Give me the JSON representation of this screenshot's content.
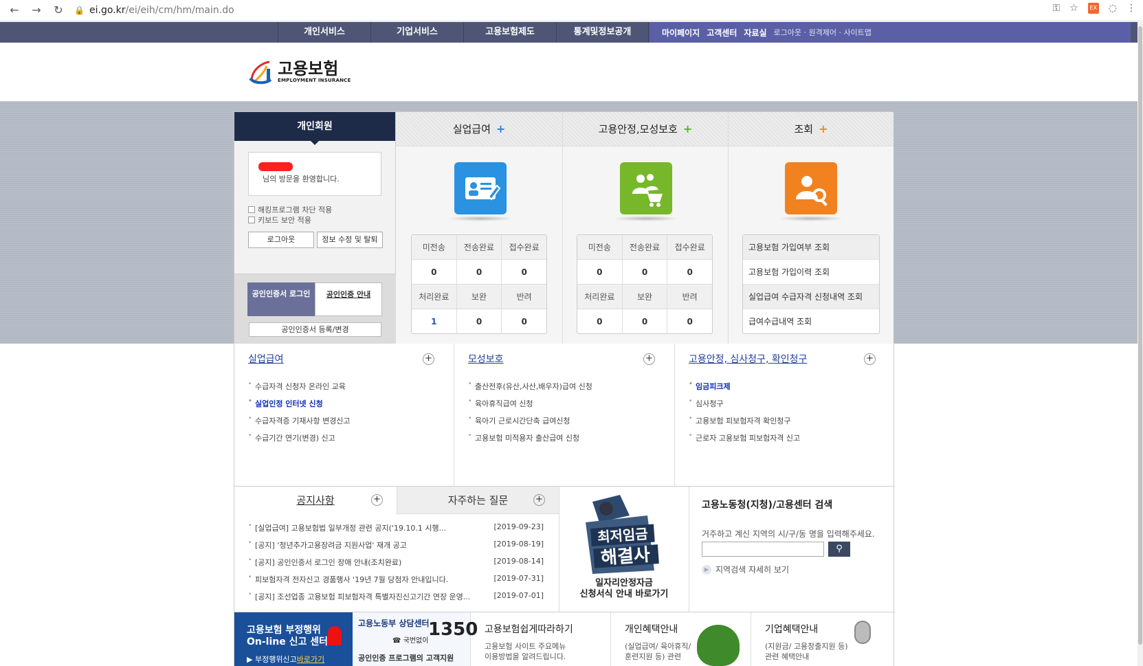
{
  "browser": {
    "host": "ei.go.kr",
    "path": "/ei/eih/cm/hm/main.do",
    "ext_label": "EX"
  },
  "gnb": {
    "items": [
      "개인서비스",
      "기업서비스",
      "고용보험제도",
      "통계및정보공개"
    ]
  },
  "util": {
    "mypage": "마이페이지",
    "customer": "고객센터",
    "data": "자료실",
    "extra": "로그아웃 · 원격제어 · 사이트맵"
  },
  "logo": {
    "ko": "고용보험",
    "en": "EMPLOYMENT INSURANCE"
  },
  "login": {
    "title": "개인회원",
    "welcome": "님의 방문을 환영합니다.",
    "check1": "해킹프로그램 차단 적용",
    "check2": "키보드 보안 적용",
    "logout": "로그아웃",
    "edit": "정보 수정 및 탈퇴",
    "cert_login": "공인인증서 로그인",
    "cert_guide": "공인인증 안내",
    "cert_reg": "공인인증서 등록/변경"
  },
  "services": [
    {
      "title": "실업급여",
      "headers": [
        "미전송",
        "전송완료",
        "접수완료",
        "처리완료",
        "보완",
        "반려"
      ],
      "values": [
        "0",
        "0",
        "0",
        "1",
        "0",
        "0"
      ]
    },
    {
      "title": "고용안정,모성보호",
      "headers": [
        "미전송",
        "전송완료",
        "접수완료",
        "처리완료",
        "보완",
        "반려"
      ],
      "values": [
        "0",
        "0",
        "0",
        "0",
        "0",
        "0"
      ]
    },
    {
      "title": "조회",
      "items": [
        "고용보험 가입여부 조회",
        "고용보험 가입이력 조회",
        "실업급여 수급자격 신청내역 조회",
        "급여수급내역 조회"
      ]
    }
  ],
  "cols": [
    {
      "title": "실업급여",
      "items": [
        "수급자격 신청자 온라인 교육",
        "실업인정 인터넷 신청",
        "수급자격증 기재사항 변경신고",
        "수급기간 연기(변경) 신고"
      ]
    },
    {
      "title": "모성보호",
      "items": [
        "출산전후(유산,사산,배우자)급여 신청",
        "육아휴직급여 신청",
        "육아기 근로시간단축 급여신청",
        "고용보험 미적용자 출산급여 신청"
      ]
    },
    {
      "title": "고용안정, 심사청구, 확인청구",
      "items": [
        "임금피크제",
        "심사청구",
        "고용보험 피보험자격 확인청구",
        "근로자 고용보험 피보험자격 신고"
      ]
    }
  ],
  "notice": {
    "tab1": "공지사항",
    "tab2": "자주하는 질문",
    "items": [
      {
        "title": "[실업급여] 고용보험법 일부개정 관련 공지('19.10.1 시행...",
        "date": "[2019-09-23]"
      },
      {
        "title": "[공지] '청년추가고용장려금 지원사업' 재개 공고",
        "date": "[2019-08-19]"
      },
      {
        "title": "[공지] 공인인증서 로그인 장애 안내(조치완료)",
        "date": "[2019-08-14]"
      },
      {
        "title": "피보험자격 전자신고 경품행사 '19년 7월 당첨자 안내입니다.",
        "date": "[2019-07-31]"
      },
      {
        "title": "[공지] 조선업종 고용보험 피보험자격 특별자진신고기간 연장 운영...",
        "date": "[2019-07-01]"
      }
    ]
  },
  "banner": {
    "big1": "최저임금",
    "big2": "해결사",
    "line1": "일자리안정자금",
    "line2": "신청서식 안내 바로가기"
  },
  "search": {
    "title": "고용노동청(지청)/고용센터 검색",
    "desc": "거주하고 계신 지역의 시/구/동 명을 입력해주세요.",
    "detail": "지역검색 자세히 보기"
  },
  "bottom": {
    "b1a": "고용보험 부정행위",
    "b1b": "On-line 신고 센터",
    "b1c": "▶ 부정행위신고",
    "b1d": "바로가기",
    "b2a": "고용노동부 상담센터",
    "b2n": "1350",
    "b2p": "☎ 국번없이",
    "b2b": "공인인증 프로그램의 고객지원",
    "b3t": "고용보험쉽게따라하기",
    "b3d1": "고용보험 사이트 주요메뉴",
    "b3d2": "이용방법을 알려드립니다.",
    "b4t": "개인혜택안내",
    "b4d1": "(실업급여/ 육아휴직/",
    "b4d2": "훈련지원 등) 관련",
    "b5t": "기업혜택안내",
    "b5d1": "(지원금/ 고용창출지원 등)",
    "b5d2": "관련 혜택안내"
  }
}
